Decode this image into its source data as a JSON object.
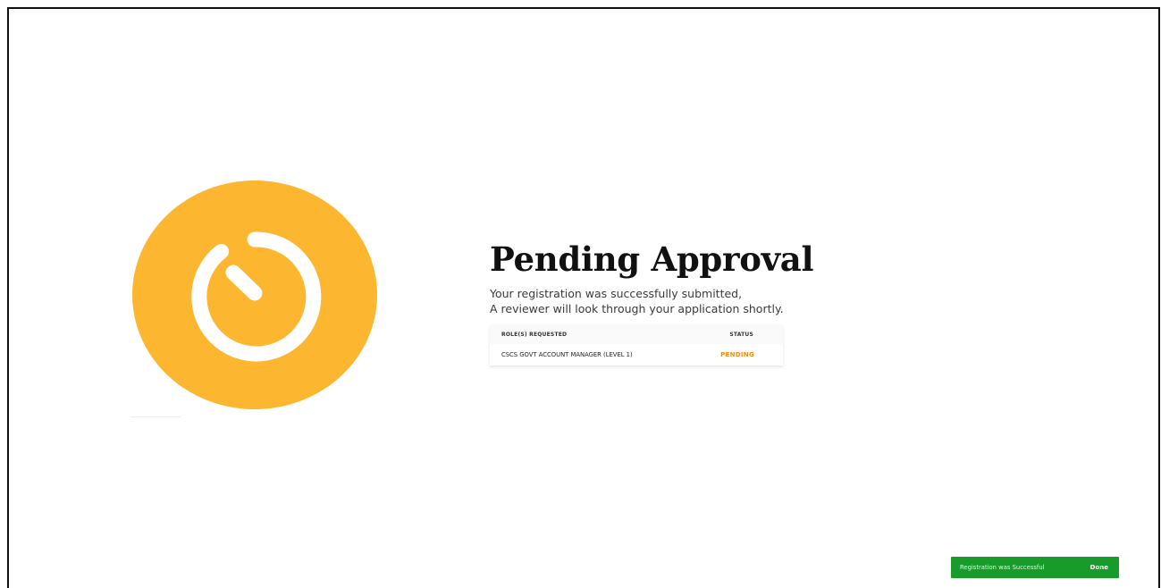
{
  "page": {
    "title": "Pending Approval",
    "message_line1": "Your registration was successfully submitted,",
    "message_line2": "A reviewer will look through your application shortly."
  },
  "roles_table": {
    "columns": [
      "ROLE(S) REQUESTED",
      "STATUS"
    ],
    "rows": [
      {
        "role": "CSCS GOVT ACCOUNT MANAGER (LEVEL 1)",
        "status": "PENDING"
      }
    ]
  },
  "toast": {
    "message": "Registration was Successful",
    "action_label": "Done"
  },
  "icons": {
    "status_icon": "pending-timer-icon"
  },
  "colors": {
    "accent": "#FDB630",
    "pending_status": "#F28C0F",
    "toast_background": "#189B2B"
  }
}
